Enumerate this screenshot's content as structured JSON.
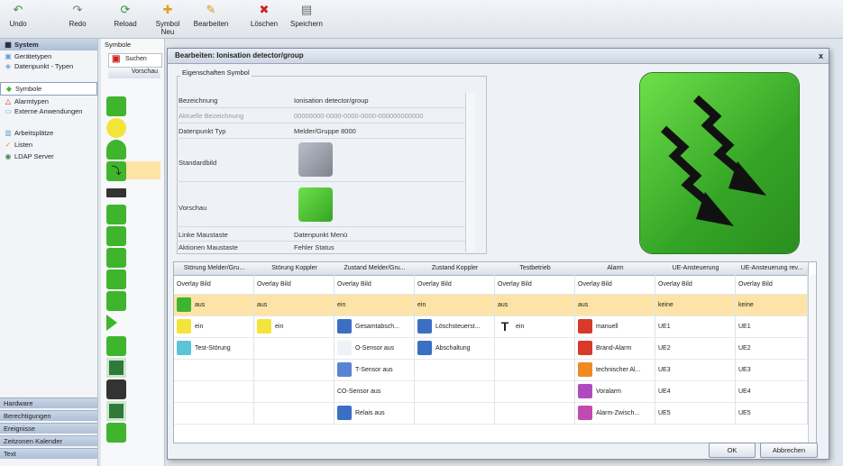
{
  "toolbar": {
    "undo": "Undo",
    "redo": "Redo",
    "reload": "Reload",
    "new_symbol": "Symbol Neu",
    "edit": "Bearbeiten",
    "delete": "Löschen",
    "save": "Speichern"
  },
  "sidebar": {
    "header": "System",
    "items": [
      "Gerätetypen",
      "Datenpunkt - Typen",
      "Symbole",
      "Alarmtypen",
      "Externe Anwendungen",
      "Arbeitsplätze",
      "Listen",
      "LDAP Server"
    ],
    "bottom": [
      "Hardware",
      "Berechtigungen",
      "Ereignisse",
      "Zeitzonen Kalender",
      "Text"
    ]
  },
  "center": {
    "title": "Symbole",
    "search": "Suchen",
    "col": "Vorschau"
  },
  "dialog": {
    "title": "Bearbeiten: Ionisation detector/group",
    "close": "x",
    "group_label": "Eigenschaften Symbol",
    "props": [
      {
        "label": "Bezeichnung",
        "value": "Ionisation detector/group"
      },
      {
        "label": "Aktuelle Bezeichnung",
        "value": "00000000-0000-0000-0000-000000000000"
      },
      {
        "label": "Datenpunkt Typ",
        "value": "Melder/Gruppe 8000"
      },
      {
        "label": "Standardbild",
        "value": ""
      },
      {
        "label": "Vorschau",
        "value": ""
      },
      {
        "label": "Linke Maustaste",
        "value": "Datenpunkt Menü"
      },
      {
        "label": "Aktionen Maustaste",
        "value": "Fehler Status"
      }
    ],
    "ok": "OK",
    "cancel": "Abbrechen"
  },
  "grid": {
    "headers": [
      "Störung Melder/Gru...",
      "Störung Koppler",
      "Zustand Melder/Gru...",
      "Zustand Koppler",
      "Testbetrieb",
      "Alarm",
      "UE-Ansteuerung",
      "UE-Ansteuerung rev..."
    ],
    "rows": [
      [
        "Overlay Bild",
        "Overlay Bild",
        "Overlay Bild",
        "Overlay Bild",
        "Overlay Bild",
        "Overlay Bild",
        "Overlay Bild",
        "Overlay Bild"
      ],
      [
        "aus",
        "aus",
        "ein",
        "ein",
        "aus",
        "aus",
        "keine",
        "keine"
      ],
      [
        "ein",
        "ein",
        "Gesamtabsch...",
        "Löschsteuerst...",
        "ein",
        "manuell",
        "UE1",
        "UE1"
      ],
      [
        "Test-Störung",
        "",
        "O-Sensor aus",
        "Abschaltung",
        "",
        "Brand-Alarm",
        "UE2",
        "UE2"
      ],
      [
        "",
        "",
        "T-Sensor aus",
        "",
        "",
        "technischer Al...",
        "UE3",
        "UE3"
      ],
      [
        "",
        "",
        "CO-Sensor aus",
        "",
        "",
        "Voralarm",
        "UE4",
        "UE4"
      ],
      [
        "",
        "",
        "Relais aus",
        "",
        "",
        "Alarm-Zwisch...",
        "UE5",
        "UE5"
      ]
    ]
  },
  "colors": {
    "green": "#3fb52e",
    "highlight": "#fde4a6",
    "title_blue": "#cdd6e2"
  }
}
